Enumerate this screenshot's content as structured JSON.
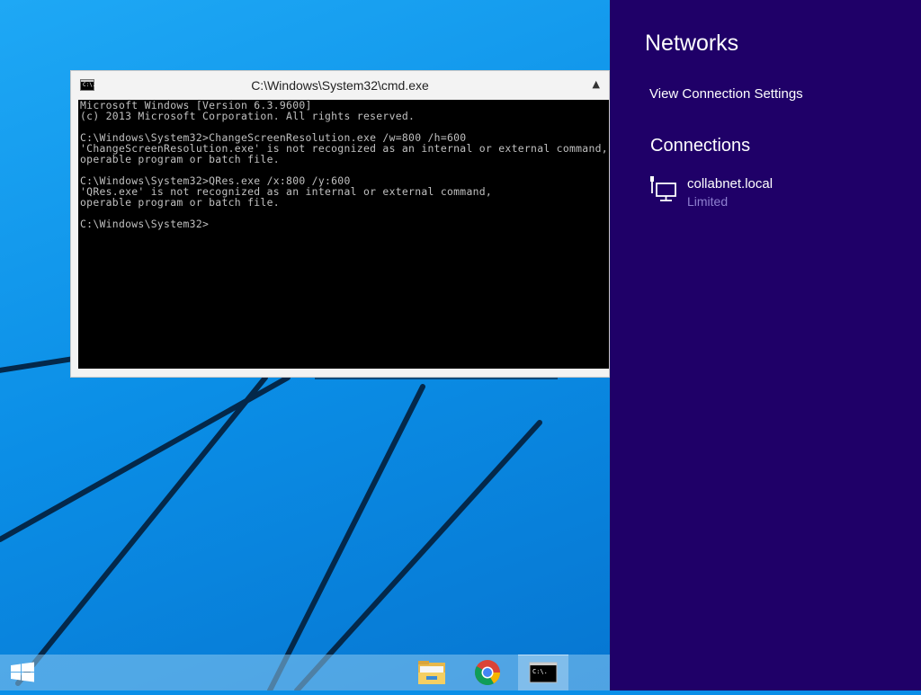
{
  "cmd_window": {
    "title": "C:\\Windows\\System32\\cmd.exe",
    "icon": "console-icon",
    "icon_text": "C:\\.",
    "scroll_up_glyph": "▲",
    "console_text": "Microsoft Windows [Version 6.3.9600]\n(c) 2013 Microsoft Corporation. All rights reserved.\n\nC:\\Windows\\System32>ChangeScreenResolution.exe /w=800 /h=600\n'ChangeScreenResolution.exe' is not recognized as an internal or external command,\noperable program or batch file.\n\nC:\\Windows\\System32>QRes.exe /x:800 /y:600\n'QRes.exe' is not recognized as an internal or external command,\noperable program or batch file.\n\nC:\\Windows\\System32>"
  },
  "charm": {
    "title": "Networks",
    "view_settings_label": "View Connection Settings",
    "connections_heading": "Connections",
    "connection": {
      "icon": "wired-network-icon",
      "name": "collabnet.local",
      "status": "Limited"
    },
    "colors": {
      "background": "#1f0068",
      "status_text": "#8e7fd0"
    }
  },
  "taskbar": {
    "start_icon": "windows-logo-icon",
    "pinned": [
      {
        "name": "File Explorer",
        "icon": "folder-icon"
      },
      {
        "name": "Google Chrome",
        "icon": "chrome-icon"
      },
      {
        "name": "Command Prompt",
        "icon": "console-icon",
        "active": true
      }
    ]
  },
  "desktop": {
    "wallpaper": "Windows 8.1 blue lines",
    "accent": "#0b8ee6"
  }
}
